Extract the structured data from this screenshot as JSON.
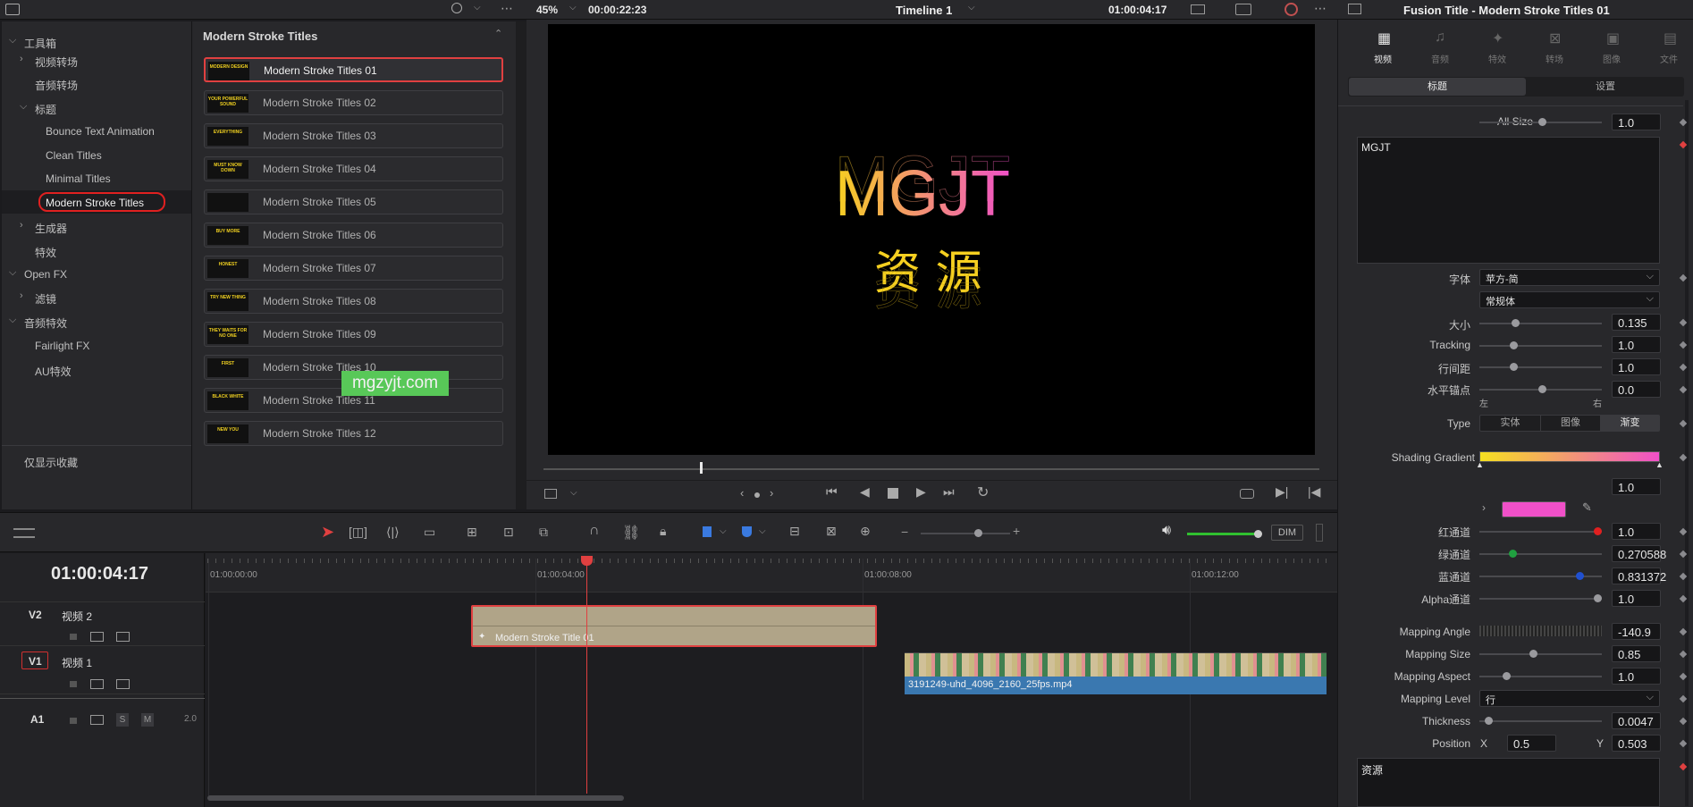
{
  "top_left": {
    "panel_icon": "panel-toggle-icon",
    "search_icon": "search-icon"
  },
  "viewer": {
    "zoom": "45%",
    "timecode_left": "00:00:22:23",
    "timeline_name": "Timeline 1",
    "timecode_right": "01:00:04:17",
    "title_main": "MGJT",
    "title_sub": "资 源"
  },
  "inspector": {
    "title": "Fusion Title - Modern Stroke Titles 01",
    "tabs": [
      "视频",
      "音频",
      "特效",
      "转场",
      "图像",
      "文件"
    ],
    "subtabs": [
      "标题",
      "设置"
    ],
    "all_size_label": "All Size",
    "all_size": "1.0",
    "text": "MGJT",
    "font_label": "字体",
    "font": "苹方-简",
    "font_style": "常规体",
    "size_label": "大小",
    "size": "0.135",
    "tracking_label": "Tracking",
    "tracking": "1.0",
    "line_label": "行间距",
    "line": "1.0",
    "anchor_label": "水平锚点",
    "anchor": "0.0",
    "anchor_left": "左",
    "anchor_right": "右",
    "type_label": "Type",
    "type_options": [
      "实体",
      "图像",
      "渐变"
    ],
    "shading_label": "Shading Gradient",
    "shading_val": "1.0",
    "red_label": "红通道",
    "red": "1.0",
    "green_label": "绿通道",
    "green": "0.270588",
    "blue_label": "蓝通道",
    "blue": "0.831372",
    "alpha_label": "Alpha通道",
    "alpha": "1.0",
    "mangle_label": "Mapping Angle",
    "mangle": "-140.9",
    "msize_label": "Mapping Size",
    "msize": "0.85",
    "maspect_label": "Mapping Aspect",
    "maspect": "1.0",
    "mlevel_label": "Mapping Level",
    "mlevel": "行",
    "thick_label": "Thickness",
    "thick": "0.0047",
    "pos_label": "Position",
    "pos_x_label": "X",
    "pos_x": "0.5",
    "pos_y_label": "Y",
    "pos_y": "0.503",
    "text2": "资源",
    "swatch_color": "#f050c8"
  },
  "toolbox": {
    "items": [
      {
        "label": "工具箱"
      },
      {
        "label": "视频转场"
      },
      {
        "label": "音频转场"
      },
      {
        "label": "标题"
      },
      {
        "label": "Bounce Text Animation"
      },
      {
        "label": "Clean Titles"
      },
      {
        "label": "Minimal Titles"
      },
      {
        "label": "Modern Stroke Titles"
      },
      {
        "label": "生成器"
      },
      {
        "label": "特效"
      },
      {
        "label": "Open FX"
      },
      {
        "label": "滤镜"
      },
      {
        "label": "音频特效"
      },
      {
        "label": "Fairlight FX"
      },
      {
        "label": "AU特效"
      }
    ],
    "favorites": "仅显示收藏"
  },
  "library": {
    "header": "Modern Stroke Titles",
    "items": [
      {
        "label": "Modern Stroke Titles 01",
        "thumb": "MODERN DESIGN"
      },
      {
        "label": "Modern Stroke Titles 02",
        "thumb": "YOUR POWERFUL SOUND"
      },
      {
        "label": "Modern Stroke Titles 03",
        "thumb": "EVERYTHING"
      },
      {
        "label": "Modern Stroke Titles 04",
        "thumb": "MUST KNOW DOWN"
      },
      {
        "label": "Modern Stroke Titles 05",
        "thumb": ""
      },
      {
        "label": "Modern Stroke Titles 06",
        "thumb": "BUY MORE"
      },
      {
        "label": "Modern Stroke Titles 07",
        "thumb": "HONEST"
      },
      {
        "label": "Modern Stroke Titles 08",
        "thumb": "TRY NEW THING"
      },
      {
        "label": "Modern Stroke Titles 09",
        "thumb": "THEY WAITS FOR NO ONE"
      },
      {
        "label": "Modern Stroke Titles 10",
        "thumb": "FIRST"
      },
      {
        "label": "Modern Stroke Titles 11",
        "thumb": "BLACK WHITE"
      },
      {
        "label": "Modern Stroke Titles 12",
        "thumb": "NEW YOU"
      }
    ]
  },
  "watermark": "mgzyjt.com",
  "timeline": {
    "timecode": "01:00:04:17",
    "ruler": [
      "01:00:00:00",
      "01:00:04:00",
      "01:00:08:00",
      "01:00:12:00"
    ],
    "tracks": [
      {
        "id": "V2",
        "name": "视频 2"
      },
      {
        "id": "V1",
        "name": "视频 1"
      },
      {
        "id": "A1",
        "name": "",
        "vol": "2.0"
      }
    ],
    "clip_title": "Modern Stroke Title  01",
    "clip_video": "3191249-uhd_4096_2160_25fps.mp4",
    "dim": "DIM",
    "solo": "S",
    "mute": "M"
  }
}
